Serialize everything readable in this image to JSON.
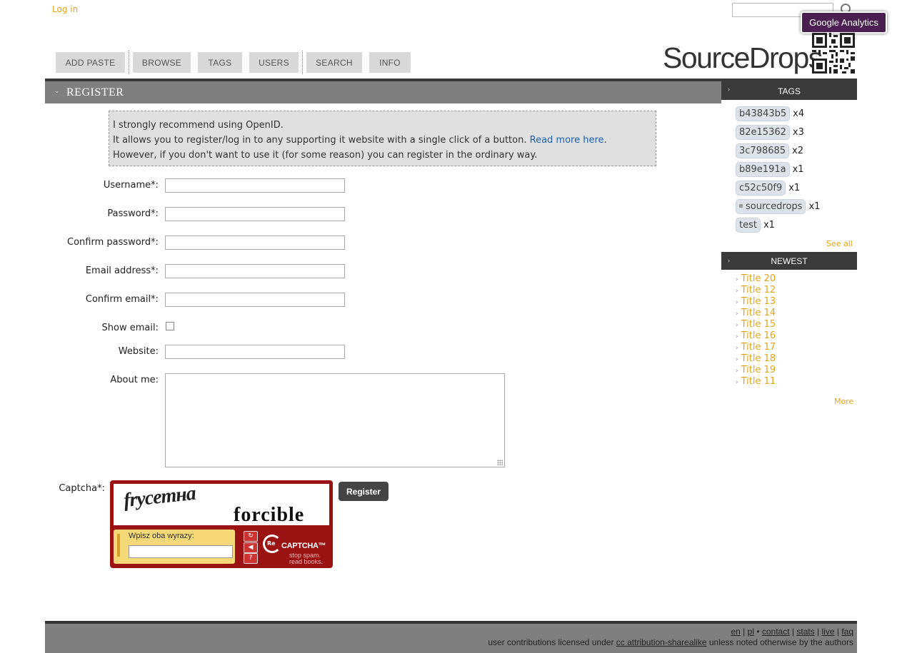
{
  "top": {
    "login": "Log in",
    "ga": "Google Analytics"
  },
  "nav": [
    {
      "label": "ADD PASTE"
    },
    {
      "label": "BROWSE"
    },
    {
      "label": "TAGS"
    },
    {
      "label": "USERS"
    },
    {
      "label": "SEARCH"
    },
    {
      "label": "INFO"
    }
  ],
  "logo": {
    "text": "SourceDrops"
  },
  "section": {
    "title": "REGISTER"
  },
  "info": {
    "line1": "I strongly recommend using OpenID.",
    "line2": "It allows you to register/log in to any supporting it website with a single click of a button.",
    "read_more": "Read more here",
    "line2_end": ".",
    "line3": "However, if you don't want to use it (for some reason) you can register in the ordinary way."
  },
  "form": {
    "username": "Username*:",
    "password": "Password*:",
    "confirm_password": "Confirm password*:",
    "email": "Email address*:",
    "confirm_email": "Confirm email*:",
    "show_email": "Show email:",
    "website": "Website:",
    "about": "About me:",
    "captcha": "Captcha*:",
    "register": "Register"
  },
  "captcha": {
    "word1": "fryceтна",
    "word2": "forcible",
    "prompt": "Wpisz oba wyrazy:",
    "re": "Re",
    "brand": "CAPTCHA™",
    "tag1": "stop spam.",
    "tag2": "read books."
  },
  "sidebar": {
    "tags_title": "TAGS",
    "tags": [
      {
        "name": "b43843b5",
        "count": "x4"
      },
      {
        "name": "82e15362",
        "count": "x3"
      },
      {
        "name": "3c798685",
        "count": "x2"
      },
      {
        "name": "b89e191a",
        "count": "x1"
      },
      {
        "name": "c52c50f9",
        "count": "x1"
      },
      {
        "name": "sourcedrops",
        "count": "x1"
      },
      {
        "name": "test",
        "count": "x1"
      }
    ],
    "see_all": "See all",
    "newest_title": "NEWEST",
    "newest": [
      "Title 20",
      "Title 12",
      "Title 13",
      "Title 14",
      "Title 15",
      "Title 16",
      "Title 17",
      "Title 18",
      "Title 19",
      "Title 11"
    ],
    "more": "More"
  },
  "footer": {
    "langs": [
      "en",
      "pl"
    ],
    "links": [
      "contact",
      "stats",
      "live",
      "faq"
    ],
    "license_pre": "user contributions licensed under ",
    "license_link": "cc attribution-sharealike",
    "license_post": " unless noted otherwise by the authors"
  }
}
